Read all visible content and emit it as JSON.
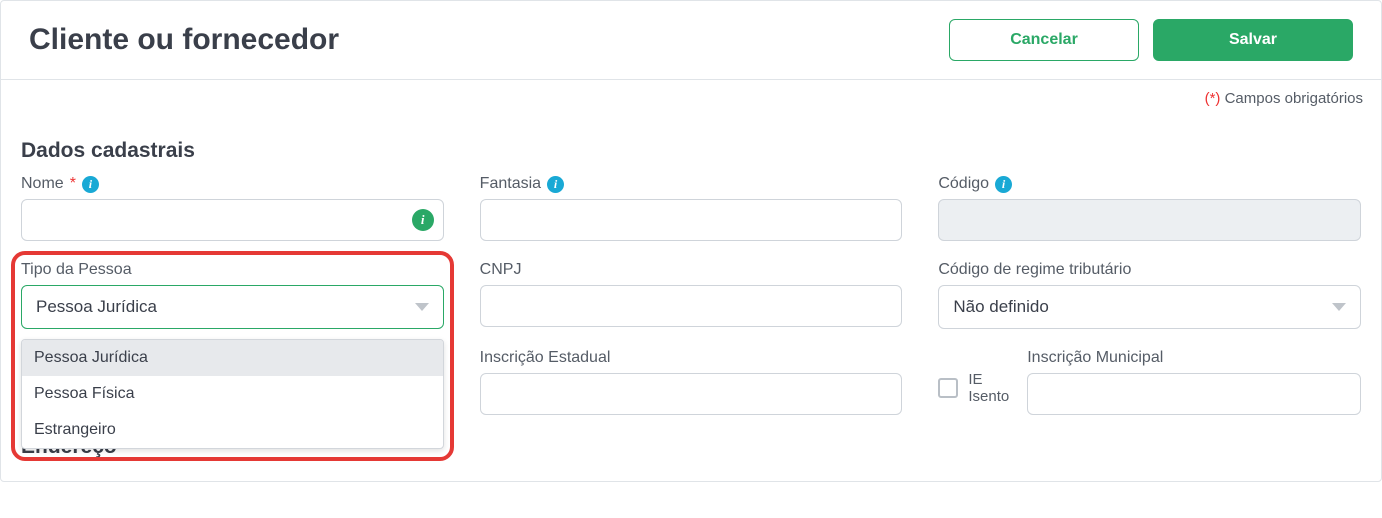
{
  "header": {
    "title": "Cliente ou fornecedor",
    "cancel": "Cancelar",
    "save": "Salvar"
  },
  "requiredNote": {
    "star": "(*)",
    "text": " Campos obrigatórios"
  },
  "sections": {
    "dados": "Dados cadastrais",
    "endereco": "Endereço"
  },
  "fields": {
    "nome": {
      "label": "Nome",
      "value": ""
    },
    "fantasia": {
      "label": "Fantasia",
      "value": ""
    },
    "codigo": {
      "label": "Código",
      "value": ""
    },
    "tipoPessoa": {
      "label": "Tipo da Pessoa",
      "selected": "Pessoa Jurídica",
      "options": [
        "Pessoa Jurídica",
        "Pessoa Física",
        "Estrangeiro"
      ]
    },
    "cnpj": {
      "label": "CNPJ",
      "value": ""
    },
    "regime": {
      "label": "Código de regime tributário",
      "selected": "Não definido"
    },
    "inscEstadual": {
      "label": "Inscrição Estadual",
      "value": ""
    },
    "ieIsento": {
      "label1": "IE",
      "label2": "Isento"
    },
    "inscMunicipal": {
      "label": "Inscrição Municipal",
      "value": ""
    }
  }
}
